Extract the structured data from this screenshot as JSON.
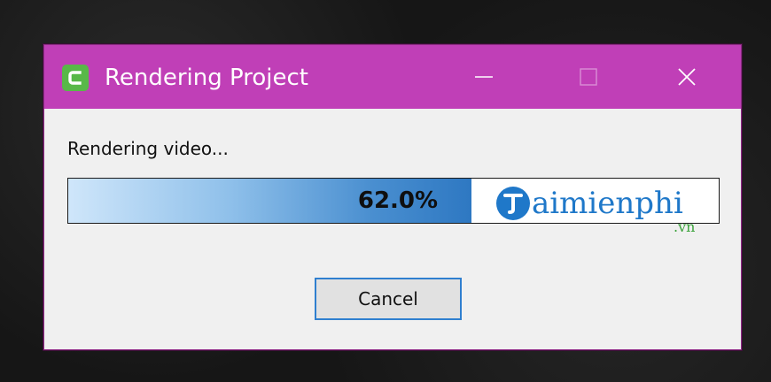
{
  "window": {
    "title": "Rendering Project",
    "titlebar_color": "#c03fb7"
  },
  "window_controls": {
    "minimize_icon": "minimize-icon",
    "maximize_icon": "maximize-icon",
    "close_icon": "close-icon"
  },
  "content": {
    "status_label": "Rendering video..."
  },
  "progress": {
    "value": 0.62,
    "label": "62.0%",
    "fill_color": "#2e78c2"
  },
  "watermark": {
    "initial": "T",
    "text": "aimienphi",
    "domain": ".vn"
  },
  "buttons": {
    "cancel_label": "Cancel"
  }
}
